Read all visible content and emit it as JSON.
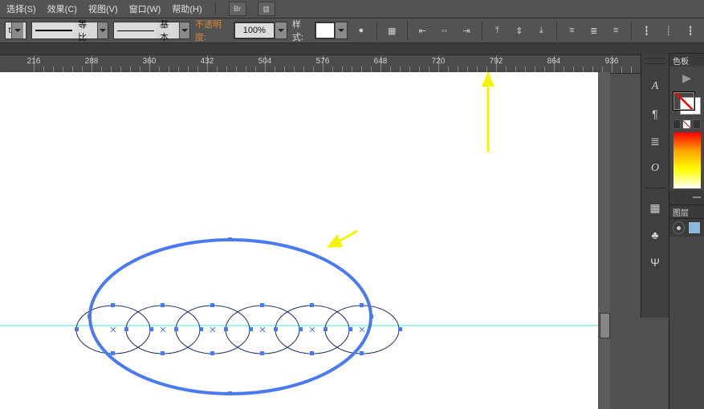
{
  "menu": {
    "select": "选择(S)",
    "effect": "效果(C)",
    "view": "视图(V)",
    "window": "窗口(W)",
    "help": "帮助(H)"
  },
  "opt": {
    "profile": "等比",
    "stroke": "基本",
    "opacity_label": "不透明度:",
    "opacity_value": "100%",
    "style_label": "样式:"
  },
  "ruler": {
    "ticks": [
      "216",
      "288",
      "360",
      "432",
      "504",
      "576",
      "648",
      "720",
      "792",
      "864",
      "936"
    ]
  },
  "panels": {
    "swatches": "色板",
    "layers": "图层"
  },
  "icons": {
    "br": "Br",
    "layout": "▥",
    "sphere": "●",
    "sel": "▦",
    "alignL": "⇤",
    "alignC": "⇔",
    "alignR": "⇥",
    "alignT": "⤒",
    "alignM": "⇕",
    "alignB": "⤓",
    "distH1": "≡",
    "distH2": "≣",
    "distH3": "≡",
    "distV1": "┇",
    "distV2": "┊",
    "distV3": "┇",
    "play": "▶",
    "typeA": "A",
    "para": "¶",
    "bars": "≣",
    "italic": "O",
    "grid": "▦",
    "club": "♣",
    "psi": "Ψ"
  }
}
